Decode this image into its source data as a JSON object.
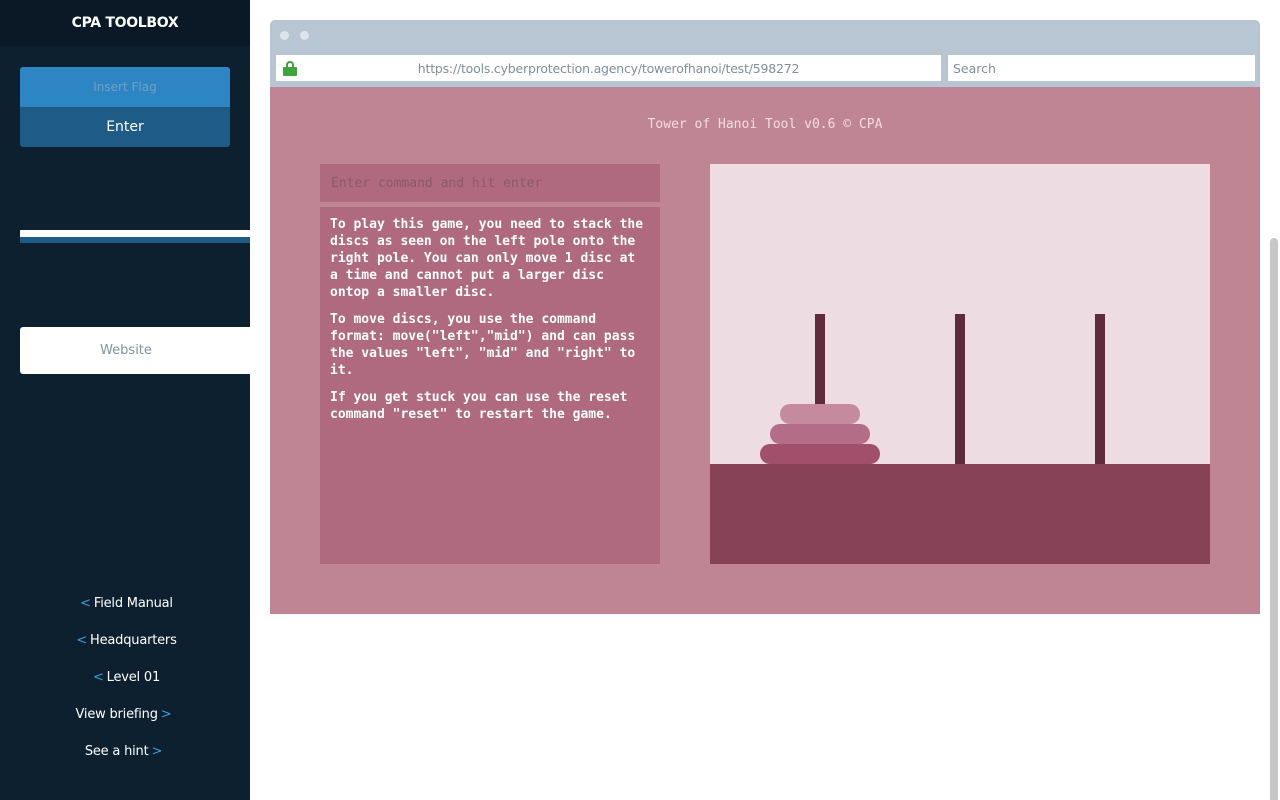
{
  "sidebar": {
    "brand": "CPA TOOLBOX",
    "flag_placeholder": "Insert Flag",
    "enter_label": "Enter",
    "website_label": "Website",
    "nav": [
      {
        "label": "Field Manual",
        "chevron": "<",
        "side": "left"
      },
      {
        "label": "Headquarters",
        "chevron": "<",
        "side": "left"
      },
      {
        "label": "Level 01",
        "chevron": "<",
        "side": "left"
      },
      {
        "label": "View briefing",
        "chevron": ">",
        "side": "right"
      },
      {
        "label": "See a hint",
        "chevron": ">",
        "side": "right"
      }
    ]
  },
  "browser": {
    "url": "https://tools.cyberprotection.agency/towerofhanoi/test/598272",
    "search_placeholder": "Search",
    "lock_icon": "lock-icon",
    "lock_color": "#3fa43c"
  },
  "tool": {
    "title": "Tower of Hanoi Tool v0.6 © CPA",
    "command_placeholder": "Enter command and hit enter",
    "instructions": [
      "To play this game, you need to stack the discs as seen on the left pole onto the right pole. You can only move 1 disc at a time and cannot put a larger disc ontop a smaller disc.",
      "To move discs, you use the command format: move(\"left\",\"mid\") and can pass the values \"left\", \"mid\" and \"right\" to it.",
      "If you get stuck you can use the reset command \"reset\" to restart the game."
    ]
  },
  "game": {
    "poles": [
      "left",
      "mid",
      "right"
    ],
    "discs": [
      {
        "pole": "left",
        "size": 3,
        "color": "#a24f6b"
      },
      {
        "pole": "left",
        "size": 2,
        "color": "#b46d86"
      },
      {
        "pole": "left",
        "size": 1,
        "color": "#c58a9e"
      }
    ]
  },
  "colors": {
    "sidebar_bg": "#0d202f",
    "accent": "#2e85c4",
    "app_bg": "#c08594",
    "panel": "#b06a7f",
    "base": "#874258",
    "pole": "#5e2a3c"
  }
}
